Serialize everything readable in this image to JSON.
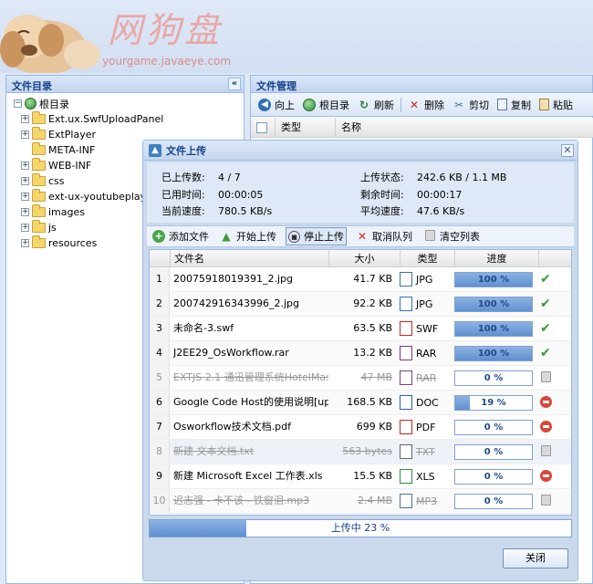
{
  "header": {
    "logo_title": "网狗盘",
    "logo_url": "yourgame.javaeye.com"
  },
  "left_panel": {
    "title": "文件目录",
    "collapse_glyph": "«",
    "root": "根目录",
    "folders": [
      "Ext.ux.SwfUploadPanel",
      "ExtPlayer",
      "META-INF",
      "WEB-INF",
      "css",
      "ext-ux-youtubeplayer",
      "images",
      "js",
      "resources"
    ]
  },
  "right_panel": {
    "title": "文件管理",
    "toolbar": {
      "up": "向上",
      "root": "根目录",
      "refresh": "刷新",
      "delete": "删除",
      "cut": "剪切",
      "copy": "复制",
      "paste": "粘贴"
    },
    "columns": {
      "type": "类型",
      "name": "名称"
    }
  },
  "upload_window": {
    "title": "文件上传",
    "info": {
      "uploaded_count_label": "已上传数:",
      "uploaded_count": "4 / 7",
      "elapsed_label": "已用时间:",
      "elapsed": "00:00:05",
      "speed_label": "当前速度:",
      "speed": "780.5 KB/s",
      "status_label": "上传状态:",
      "status": "242.6 KB / 1.1 MB",
      "remaining_label": "剩余时间:",
      "remaining": "00:00:17",
      "avg_speed_label": "平均速度:",
      "avg_speed": "47.6 KB/s"
    },
    "actions": {
      "add": "添加文件",
      "start": "开始上传",
      "stop": "停止上传",
      "cancel": "取消队列",
      "clear": "清空列表"
    },
    "columns": {
      "name": "文件名",
      "size": "大小",
      "type": "类型",
      "progress": "进度"
    },
    "files": [
      {
        "num": "1",
        "name": "20075918019391_2.jpg",
        "size": "41.7 KB",
        "type": "JPG",
        "progress": 100,
        "progress_text": "100 %",
        "status": "done"
      },
      {
        "num": "2",
        "name": "200742916343996_2.jpg",
        "size": "92.2 KB",
        "type": "JPG",
        "progress": 100,
        "progress_text": "100 %",
        "status": "done"
      },
      {
        "num": "3",
        "name": "未命名-3.swf",
        "size": "63.5 KB",
        "type": "SWF",
        "progress": 100,
        "progress_text": "100 %",
        "status": "done"
      },
      {
        "num": "4",
        "name": "J2EE29_OsWorkflow.rar",
        "size": "13.2 KB",
        "type": "RAR",
        "progress": 100,
        "progress_text": "100 %",
        "status": "done"
      },
      {
        "num": "5",
        "name": "EXTJS 2.1 通迅管理系统HotelMas",
        "size": "47 MB",
        "type": "RAR",
        "progress": 0,
        "progress_text": "0 %",
        "status": "cancelled"
      },
      {
        "num": "6",
        "name": "Google Code Host的使用说明[upda",
        "size": "168.5 KB",
        "type": "DOC",
        "progress": 19,
        "progress_text": "19 %",
        "status": "pending"
      },
      {
        "num": "7",
        "name": "Osworkflow技术文档.pdf",
        "size": "699 KB",
        "type": "PDF",
        "progress": 0,
        "progress_text": "0 %",
        "status": "pending"
      },
      {
        "num": "8",
        "name": "新建 文本文档.txt",
        "size": "563 bytes",
        "type": "TXT",
        "progress": 0,
        "progress_text": "0 %",
        "status": "cancelled"
      },
      {
        "num": "9",
        "name": "新建 Microsoft Excel 工作表.xls",
        "size": "15.5 KB",
        "type": "XLS",
        "progress": 0,
        "progress_text": "0 %",
        "status": "pending"
      },
      {
        "num": "10",
        "name": "迟志强 - 卡不该 - 铁窗泪.mp3",
        "size": "2.4 MB",
        "type": "MP3",
        "progress": 0,
        "progress_text": "0 %",
        "status": "cancelled"
      }
    ],
    "total_progress": 23,
    "total_text": "上传中 23 %",
    "close": "关闭"
  }
}
